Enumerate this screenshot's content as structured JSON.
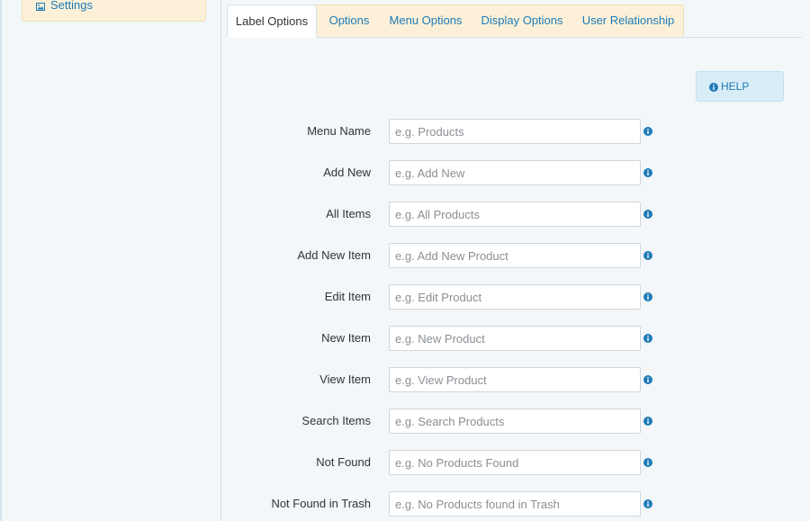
{
  "sidebar": {
    "settings_label": "Settings",
    "settings_icon": "image-icon"
  },
  "tabs": [
    {
      "label": "Label Options",
      "active": true
    },
    {
      "label": "Options",
      "active": false
    },
    {
      "label": "Menu Options",
      "active": false
    },
    {
      "label": "Display Options",
      "active": false
    },
    {
      "label": "User Relationship",
      "active": false
    }
  ],
  "help": {
    "label": "HELP",
    "icon": "info-circle-icon"
  },
  "fields": [
    {
      "label": "Menu Name",
      "placeholder": "e.g. Products"
    },
    {
      "label": "Add New",
      "placeholder": "e.g. Add New"
    },
    {
      "label": "All Items",
      "placeholder": "e.g. All Products"
    },
    {
      "label": "Add New Item",
      "placeholder": "e.g. Add New Product"
    },
    {
      "label": "Edit Item",
      "placeholder": "e.g. Edit Product"
    },
    {
      "label": "New Item",
      "placeholder": "e.g. New Product"
    },
    {
      "label": "View Item",
      "placeholder": "e.g. View Product"
    },
    {
      "label": "Search Items",
      "placeholder": "e.g. Search Products"
    },
    {
      "label": "Not Found",
      "placeholder": "e.g. No Products Found"
    },
    {
      "label": "Not Found in Trash",
      "placeholder": "e.g. No Products found in Trash"
    }
  ],
  "colors": {
    "accent": "#1e7ab7",
    "tab_bg": "#fcf1d8",
    "help_bg": "#d9edf7"
  }
}
